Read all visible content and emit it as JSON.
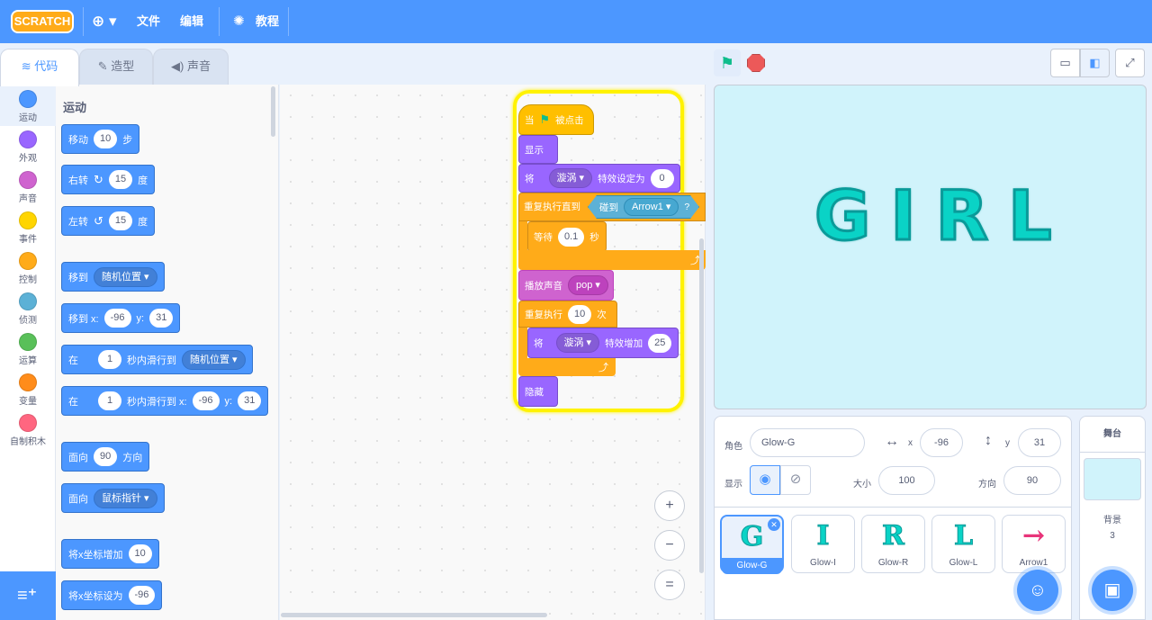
{
  "menubar": {
    "logo": "SCRATCH",
    "file": "文件",
    "edit": "编辑",
    "tutorials": "教程",
    "icons": {
      "globe": "globe-icon",
      "tutorial": "lightbulb-icon"
    }
  },
  "tabs": [
    {
      "label": "代码",
      "icon": "code-icon"
    },
    {
      "label": "造型",
      "icon": "brush-icon"
    },
    {
      "label": "声音",
      "icon": "speaker-icon"
    }
  ],
  "categories": [
    {
      "label": "运动",
      "color": "#4c97ff"
    },
    {
      "label": "外观",
      "color": "#9966ff"
    },
    {
      "label": "声音",
      "color": "#cf63cf"
    },
    {
      "label": "事件",
      "color": "#ffd500"
    },
    {
      "label": "控制",
      "color": "#ffab19"
    },
    {
      "label": "侦测",
      "color": "#5cb1d6"
    },
    {
      "label": "运算",
      "color": "#59c059"
    },
    {
      "label": "变量",
      "color": "#ff8c1a"
    },
    {
      "label": "自制积木",
      "color": "#ff6680"
    }
  ],
  "palette": {
    "title": "运动",
    "move": {
      "label": "移动",
      "value": "10",
      "unit": "步"
    },
    "turn_right": {
      "label": "右转",
      "value": "15",
      "unit": "度"
    },
    "turn_left": {
      "label": "左转",
      "value": "15",
      "unit": "度"
    },
    "goto": {
      "label": "移到",
      "dropdown": "随机位置"
    },
    "goto_xy": {
      "label": "移到 x:",
      "x": "-96",
      "ylabel": "y:",
      "y": "31"
    },
    "glide": {
      "label": "在",
      "secs": "1",
      "mid": "秒内滑行到",
      "dropdown": "随机位置"
    },
    "glide_xy": {
      "label": "在",
      "secs": "1",
      "mid": "秒内滑行到 x:",
      "x": "-96",
      "ylabel": "y:",
      "y": "31"
    },
    "point_dir": {
      "label": "面向",
      "value": "90",
      "unit": "方向"
    },
    "point_towards": {
      "label": "面向",
      "dropdown": "鼠标指针"
    },
    "change_x": {
      "label": "将x坐标增加",
      "value": "10"
    },
    "set_x": {
      "label": "将x坐标设为",
      "value": "-96"
    }
  },
  "script": {
    "hat": {
      "label": "当",
      "suffix": "被点击"
    },
    "show": "显示",
    "set_effect": {
      "label": "将",
      "effect": "漩涡",
      "mid": "特效设定为",
      "value": "0"
    },
    "repeat_until": {
      "label": "重复执行直到",
      "touch": "碰到",
      "target": "Arrow1",
      "q": "?"
    },
    "wait": {
      "label": "等待",
      "value": "0.1",
      "unit": "秒"
    },
    "play_sound": {
      "label": "播放声音",
      "sound": "pop"
    },
    "repeat": {
      "label": "重复执行",
      "value": "10",
      "unit": "次"
    },
    "change_effect": {
      "label": "将",
      "effect": "漩涡",
      "mid": "特效增加",
      "value": "25"
    },
    "hide": "隐藏"
  },
  "zoom": {
    "in": "+",
    "out": "−",
    "reset": "="
  },
  "stage": {
    "text": "GIRL"
  },
  "sprite": {
    "label": "角色",
    "name": "Glow-G",
    "x_label": "x",
    "x": "-96",
    "y_label": "y",
    "y": "31",
    "show_label": "显示",
    "size_label": "大小",
    "size": "100",
    "direction_label": "方向",
    "direction": "90"
  },
  "sprites": [
    {
      "name": "Glow-G",
      "glyph": "G"
    },
    {
      "name": "Glow-I",
      "glyph": "I"
    },
    {
      "name": "Glow-R",
      "glyph": "R"
    },
    {
      "name": "Glow-L",
      "glyph": "L"
    },
    {
      "name": "Arrow1",
      "glyph": "→"
    }
  ],
  "stage_pane": {
    "title": "舞台",
    "backdrop_label": "背景",
    "backdrop_count": "3"
  }
}
